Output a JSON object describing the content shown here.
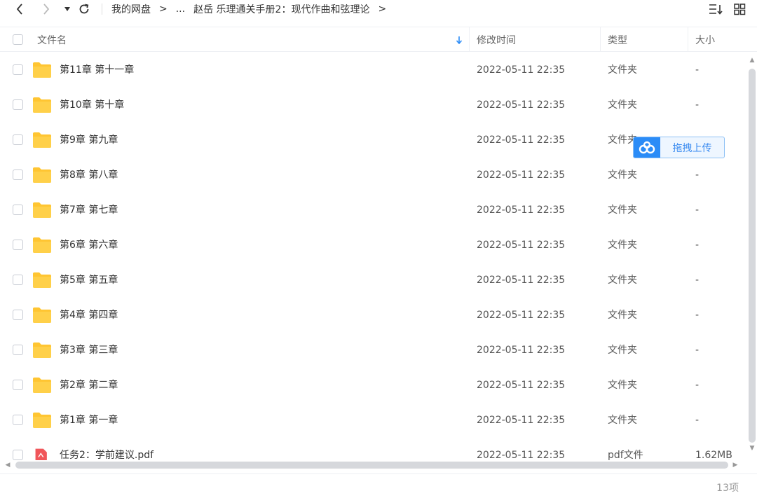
{
  "breadcrumb": {
    "items": [
      "我的网盘",
      "...",
      "赵岳 乐理通关手册2：现代作曲和弦理论"
    ],
    "separator": ">"
  },
  "header": {
    "name": "文件名",
    "modified": "修改时间",
    "type": "类型",
    "size": "大小"
  },
  "files": [
    {
      "name": "第11章 第十一章",
      "time": "2022-05-11 22:35",
      "type": "文件夹",
      "size": "-",
      "icon": "folder-icon"
    },
    {
      "name": "第10章 第十章",
      "time": "2022-05-11 22:35",
      "type": "文件夹",
      "size": "-",
      "icon": "folder-icon"
    },
    {
      "name": "第9章 第九章",
      "time": "2022-05-11 22:35",
      "type": "文件夹",
      "size": "",
      "icon": "folder-icon"
    },
    {
      "name": "第8章 第八章",
      "time": "2022-05-11 22:35",
      "type": "文件夹",
      "size": "-",
      "icon": "folder-icon"
    },
    {
      "name": "第7章 第七章",
      "time": "2022-05-11 22:35",
      "type": "文件夹",
      "size": "-",
      "icon": "folder-icon"
    },
    {
      "name": "第6章 第六章",
      "time": "2022-05-11 22:35",
      "type": "文件夹",
      "size": "-",
      "icon": "folder-icon"
    },
    {
      "name": "第5章 第五章",
      "time": "2022-05-11 22:35",
      "type": "文件夹",
      "size": "-",
      "icon": "folder-icon"
    },
    {
      "name": "第4章 第四章",
      "time": "2022-05-11 22:35",
      "type": "文件夹",
      "size": "-",
      "icon": "folder-icon"
    },
    {
      "name": "第3章 第三章",
      "time": "2022-05-11 22:35",
      "type": "文件夹",
      "size": "-",
      "icon": "folder-icon"
    },
    {
      "name": "第2章 第二章",
      "time": "2022-05-11 22:35",
      "type": "文件夹",
      "size": "-",
      "icon": "folder-icon"
    },
    {
      "name": "第1章 第一章",
      "time": "2022-05-11 22:35",
      "type": "文件夹",
      "size": "-",
      "icon": "folder-icon"
    },
    {
      "name": "任务2：学前建议.pdf",
      "time": "2022-05-11 22:35",
      "type": "pdf文件",
      "size": "1.62MB",
      "icon": "pdf-icon"
    }
  ],
  "upload": {
    "label": "拖拽上传",
    "icon": "cloud-upload-icon"
  },
  "footer": {
    "count": "13项"
  },
  "colors": {
    "folder": "#ffc532",
    "pdf": "#f0565a",
    "accent": "#2b8cf7",
    "sort_arrow": "#2b8cf7"
  }
}
